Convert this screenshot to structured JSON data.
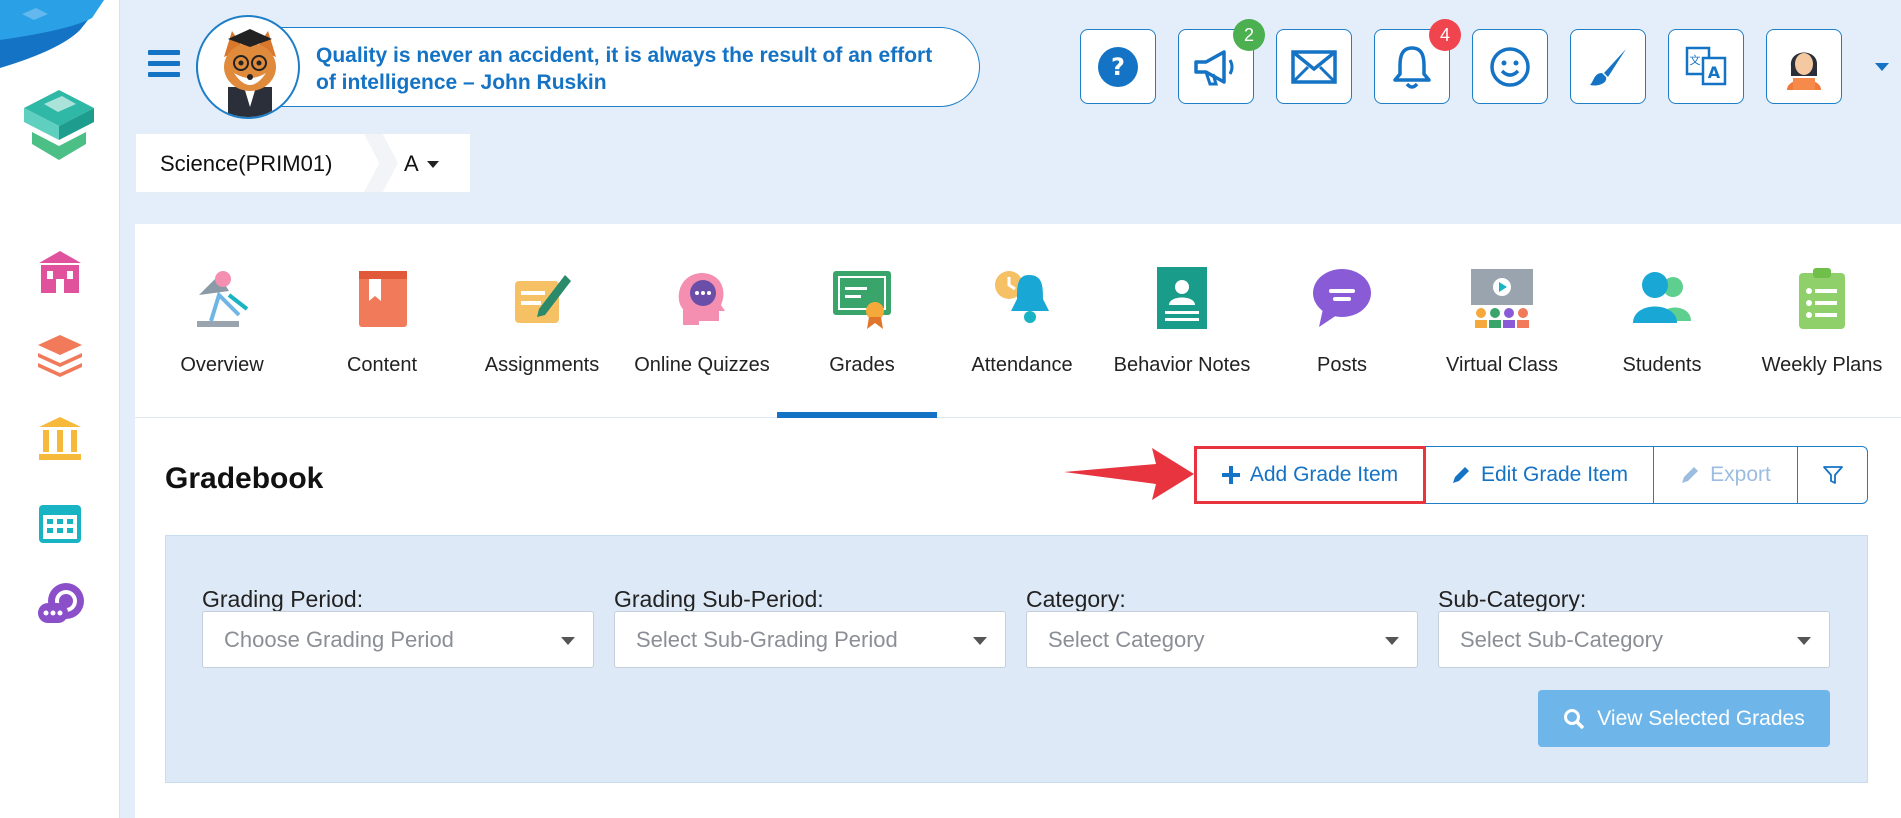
{
  "header": {
    "quote": "Quality is never an accident, it is always the result of an effort of intelligence – John Ruskin",
    "buttons": [
      {
        "name": "help-icon",
        "badge": ""
      },
      {
        "name": "megaphone-icon",
        "badge": "2",
        "badge_color": "#4caf50"
      },
      {
        "name": "mail-icon",
        "badge": ""
      },
      {
        "name": "bell-icon",
        "badge": "4",
        "badge_color": "#f0454f"
      },
      {
        "name": "smiley-icon",
        "badge": ""
      },
      {
        "name": "brush-icon",
        "badge": ""
      },
      {
        "name": "translate-icon",
        "badge": ""
      },
      {
        "name": "user-avatar-icon",
        "badge": ""
      }
    ]
  },
  "course": {
    "name": "Science(PRIM01)",
    "section": "A"
  },
  "tabs": [
    {
      "label": "Overview",
      "icon": "lamp-icon"
    },
    {
      "label": "Content",
      "icon": "book-icon"
    },
    {
      "label": "Assignments",
      "icon": "pen-paper-icon"
    },
    {
      "label": "Online Quizzes",
      "icon": "head-chat-icon"
    },
    {
      "label": "Grades",
      "icon": "certificate-icon",
      "active": true
    },
    {
      "label": "Attendance",
      "icon": "alarm-bell-icon"
    },
    {
      "label": "Behavior Notes",
      "icon": "id-card-icon"
    },
    {
      "label": "Posts",
      "icon": "speech-bubble-icon"
    },
    {
      "label": "Virtual Class",
      "icon": "presentation-icon"
    },
    {
      "label": "Students",
      "icon": "people-icon"
    },
    {
      "label": "Weekly Plans",
      "icon": "clipboard-icon"
    }
  ],
  "gradebook": {
    "title": "Gradebook",
    "add_label": "Add Grade Item",
    "edit_label": "Edit Grade Item",
    "export_label": "Export"
  },
  "filters": {
    "grading_period_label": "Grading Period:",
    "grading_period_placeholder": "Choose Grading Period",
    "sub_period_label": "Grading Sub-Period:",
    "sub_period_placeholder": "Select Sub-Grading Period",
    "category_label": "Category:",
    "category_placeholder": "Select Category",
    "sub_category_label": "Sub-Category:",
    "sub_category_placeholder": "Select Sub-Category",
    "view_button": "View Selected Grades"
  },
  "colors": {
    "primary": "#1473c4",
    "highlight": "#e8343f",
    "panel": "#dde9f6"
  }
}
